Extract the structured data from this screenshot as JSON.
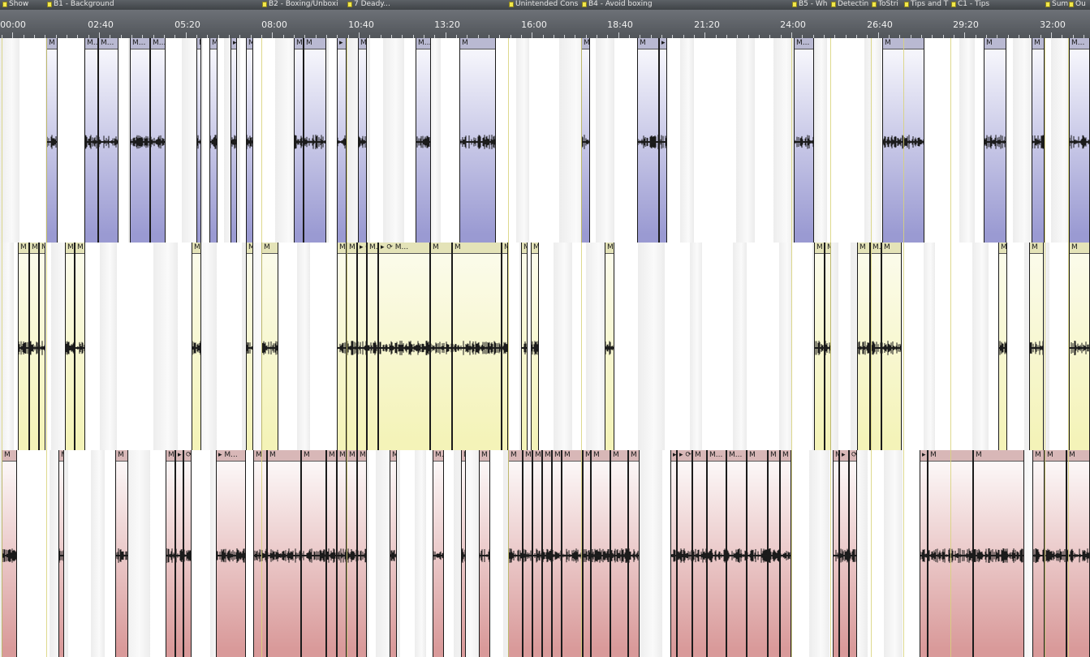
{
  "markers": [
    {
      "label": "Show"
    },
    {
      "label": "B1 - Background"
    },
    {
      "label": "B2 - Boxing/Unboxi"
    },
    {
      "label": "7 Deady..."
    },
    {
      "label": "Unintended Cons"
    },
    {
      "label": "B4 - Avoid boxing"
    },
    {
      "label": "B5 - Wh"
    },
    {
      "label": "Detectin"
    },
    {
      "label": "ToStri"
    },
    {
      "label": "Tips and T"
    },
    {
      "label": "C1 - Tips"
    },
    {
      "label": "Sum"
    },
    {
      "label": "Ou"
    }
  ],
  "ruler": {
    "labels": [
      "00:00",
      "02:40",
      "05:20",
      "08:00",
      "10:40",
      "13:20",
      "16:00",
      "18:40",
      "21:20",
      "24:00",
      "26:40",
      "29:20",
      "32:00"
    ]
  },
  "tracks": [
    {
      "name": "track-1",
      "color_top": "#f4f4fb",
      "color_bottom": "#9a9ad2",
      "header_color": "#b9b9d2",
      "clip_labels": [
        "M",
        "M...",
        "M...",
        "M...",
        "M...",
        "M...",
        "M",
        "▸ M...",
        "M",
        "M",
        "M",
        "▸ MO...",
        "M",
        "M...",
        "M",
        "M",
        "M",
        "▸ ⟳ M...",
        "M...",
        "M",
        "M"
      ]
    },
    {
      "name": "track-2",
      "color_top": "#fbfbe9",
      "color_bottom": "#f4f3b8",
      "header_color": "#e4e3b8",
      "clip_labels": [
        "M",
        "M",
        "M",
        "M",
        "M",
        "M",
        "M...",
        "M",
        "M",
        "M",
        "▸ ⟳ MO...",
        "M...",
        "▸ ⟳ M...",
        "M",
        "M",
        "M",
        "M",
        "M",
        "M",
        "M",
        "M...",
        "M",
        "M..."
      ]
    },
    {
      "name": "track-3",
      "color_top": "#fbf5f5",
      "color_bottom": "#d99a9a",
      "header_color": "#d8b7b7",
      "clip_labels": [
        "M",
        "M",
        "M",
        "M",
        "▸ M...",
        "⟳ M...",
        "▸ M...",
        "M",
        "M",
        "M",
        "M",
        "M",
        "M",
        "M",
        "M",
        "M...",
        "M...",
        "M",
        "M",
        "M",
        "M",
        "M",
        "M",
        "M",
        "M",
        "M",
        "M",
        "M",
        "▸ ⟳ M...",
        "▸ ⟳ MO...",
        "M",
        "M...",
        "M..."
      ]
    }
  ]
}
